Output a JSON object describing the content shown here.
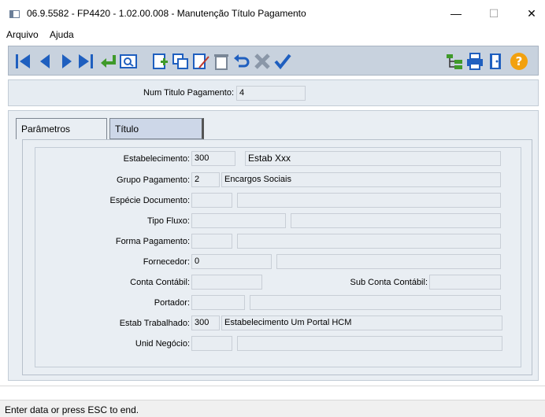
{
  "window": {
    "title": "06.9.5582 - FP4420 - 1.02.00.008 - Manutenção Título Pagamento",
    "minimize": "—",
    "maximize": "☐",
    "close": "✕"
  },
  "menu": [
    "Arquivo",
    "Ajuda"
  ],
  "toolbar": {
    "icons": [
      "first-record-icon",
      "previous-record-icon",
      "next-record-icon",
      "last-record-icon",
      "goto-icon",
      "search-icon",
      "new-record-icon",
      "copy-record-icon",
      "edit-record-icon",
      "delete-record-icon",
      "undo-icon",
      "cancel-icon",
      "confirm-icon",
      "tree-icon",
      "print-icon",
      "exit-door-icon",
      "help-icon"
    ],
    "accent": "#1f5fbf"
  },
  "header": {
    "num_label": "Num Titulo Pagamento:",
    "num_value": "4"
  },
  "tabs": [
    {
      "label": "Parâmetros"
    },
    {
      "label": "Título"
    }
  ],
  "form": {
    "estabelecimento": {
      "label": "Estabelecimento:",
      "code": "300",
      "desc": "Estab Xxx"
    },
    "grupo": {
      "label": "Grupo Pagamento:",
      "code": "2",
      "desc": "Encargos Sociais"
    },
    "especie": {
      "label": "Espécie Documento:",
      "code": "",
      "desc": ""
    },
    "tipo_fluxo": {
      "label": "Tipo Fluxo:",
      "code": "",
      "desc": ""
    },
    "forma": {
      "label": "Forma Pagamento:",
      "code": "",
      "desc": ""
    },
    "fornecedor": {
      "label": "Fornecedor:",
      "code": "0",
      "desc": ""
    },
    "conta": {
      "label": "Conta Contábil:",
      "value": ""
    },
    "subconta": {
      "label": "Sub Conta Contábil:",
      "value": ""
    },
    "portador": {
      "label": "Portador:",
      "code": "",
      "desc": ""
    },
    "estab_trab": {
      "label": "Estab Trabalhado:",
      "code": "300",
      "desc": "Estabelecimento Um Portal HCM"
    },
    "unid": {
      "label": "Unid Negócio:",
      "code": "",
      "desc": ""
    }
  },
  "status": "Enter data or press ESC to end."
}
